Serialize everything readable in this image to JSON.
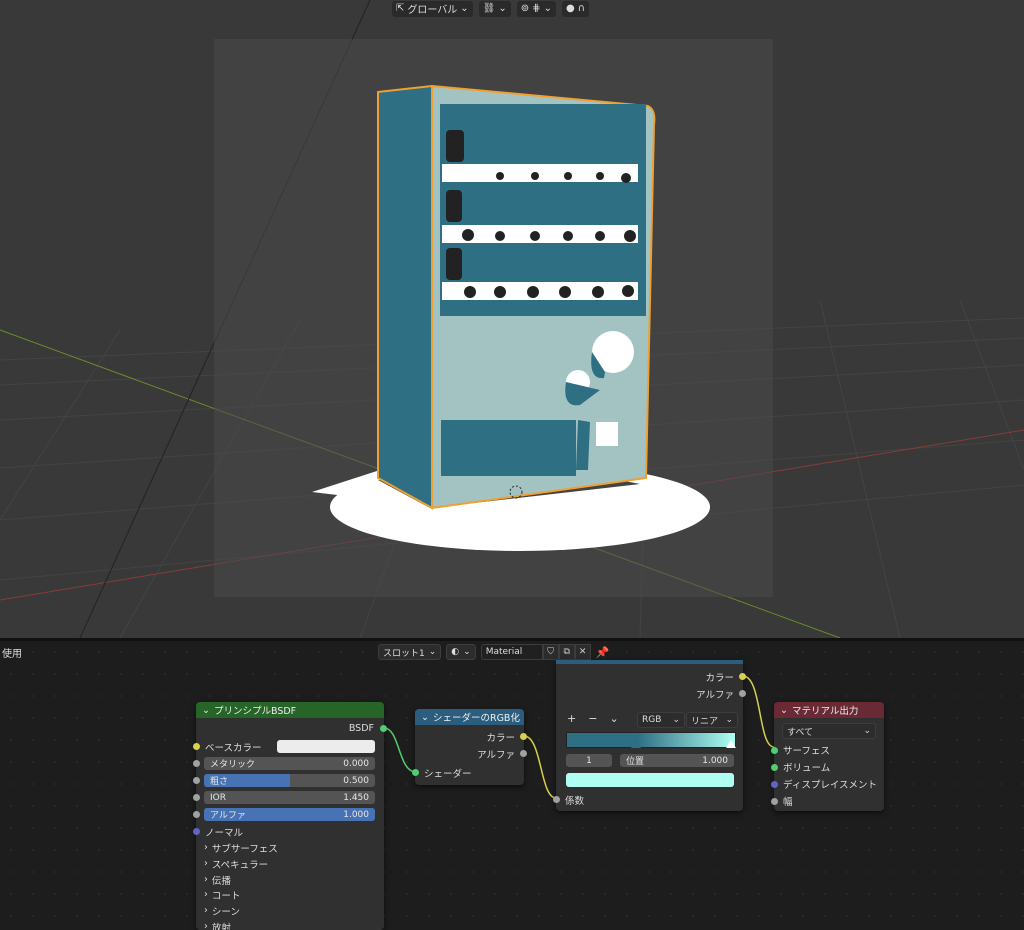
{
  "viewport": {
    "header": {
      "transform_orientation": "グローバル",
      "colors": {
        "background": "#393939",
        "object_dark": "#2f6f84",
        "object_light": "#a3c3c2",
        "selection": "#f0a030"
      }
    }
  },
  "node_editor": {
    "left_label": "使用",
    "header": {
      "slot": "スロット1",
      "material_name": "Material"
    },
    "nodes": {
      "bsdf": {
        "title": "プリンシプルBSDF",
        "output_bsdf": "BSDF",
        "base_color_label": "ベースカラー",
        "metallic_label": "メタリック",
        "metallic_value": "0.000",
        "roughness_label": "粗さ",
        "roughness_value": "0.500",
        "roughness_fraction": 0.5,
        "ior_label": "IOR",
        "ior_value": "1.450",
        "alpha_label": "アルファ",
        "alpha_value": "1.000",
        "alpha_fraction": 1.0,
        "normal_label": "ノーマル",
        "panels": [
          "サブサーフェス",
          "スペキュラー",
          "伝播",
          "コート",
          "シーン",
          "放射"
        ]
      },
      "shader_to_rgb": {
        "title": "シェーダーのRGB化",
        "out_color": "カラー",
        "out_alpha": "アルファ",
        "in_shader": "シェーダー"
      },
      "color_ramp": {
        "out_color": "カラー",
        "out_alpha": "アルファ",
        "add": "+",
        "remove": "−",
        "color_mode": "RGB",
        "interpolation": "リニア",
        "stop_index": "1",
        "position_label": "位置",
        "position_value": "1.000",
        "in_factor": "係数",
        "ramp_start_color": "#2f6f84",
        "ramp_end_color": "#aefff2"
      },
      "material_output": {
        "title": "マテリアル出力",
        "target": "すべて",
        "surface": "サーフェス",
        "volume": "ボリューム",
        "displacement": "ディスプレイスメント",
        "thickness": "幅"
      }
    }
  }
}
